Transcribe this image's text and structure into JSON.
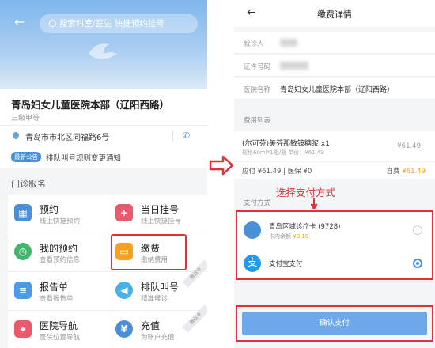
{
  "left": {
    "search_placeholder": "搜索科室/医生 快捷预约挂号",
    "hospital_name": "青岛妇女儿童医院本部（辽阳西路）",
    "hospital_level": "三级甲等",
    "address": "青岛市市北区同福路6号",
    "notice_badge": "最新公告",
    "notice_text": "排队叫号规则变更通知",
    "section_title": "门诊服务",
    "services": [
      {
        "title": "预约",
        "sub": "线上快捷预约",
        "icon": "calendar-icon",
        "color": "#4a90d9"
      },
      {
        "title": "当日挂号",
        "sub": "线上快捷挂号",
        "icon": "plus-icon",
        "color": "#e85a6c"
      },
      {
        "title": "我的预约",
        "sub": "查看预约信息",
        "icon": "clock-icon",
        "color": "#3fb66b"
      },
      {
        "title": "缴费",
        "sub": "缴纳费用",
        "icon": "card-icon",
        "color": "#f3a321"
      },
      {
        "title": "报告单",
        "sub": "查看报告单",
        "icon": "report-icon",
        "color": "#4a9be8"
      },
      {
        "title": "排队叫号",
        "sub": "精准候诊",
        "icon": "speaker-icon",
        "color": "#4ab0e8"
      },
      {
        "title": "医院导航",
        "sub": "医院位置导航",
        "icon": "location-icon",
        "color": "#e85a6c"
      },
      {
        "title": "充值",
        "sub": "为账户充值",
        "icon": "recharge-icon",
        "color": "#4a90d9"
      }
    ],
    "ribbon_1": "就诊卡",
    "ribbon_2": "就诊卡"
  },
  "right": {
    "page_title": "缴费详情",
    "visitor_label": "就诊人",
    "id_label": "证件号码",
    "hospital_label": "医院名称",
    "hospital_value": "青岛妇女儿童医院本部（辽阳西路）",
    "fee_list_label": "费用列表",
    "item_name": "(尔可芬)美芬那敏铵糖浆 x1",
    "item_spec": "规格60ml*1瓶/瓶  单价：¥61.49",
    "item_price": "¥61.49",
    "totals": "应付 ¥61.49  |  医保 ¥0",
    "self_pay_label": "自费",
    "self_pay_value": "¥61.49",
    "pay_method_label": "支付方式",
    "annotation": "选择支付方式",
    "card_name": "青岛区域诊疗卡 (9728)",
    "card_balance_label": "卡内余额",
    "card_balance_value": "¥0.18",
    "alipay_name": "支付宝支付",
    "confirm_button": "确认支付"
  },
  "colors": {
    "accent_blue": "#4a90d9",
    "highlight_red": "#e0313a",
    "price_orange": "#f39a1e"
  }
}
